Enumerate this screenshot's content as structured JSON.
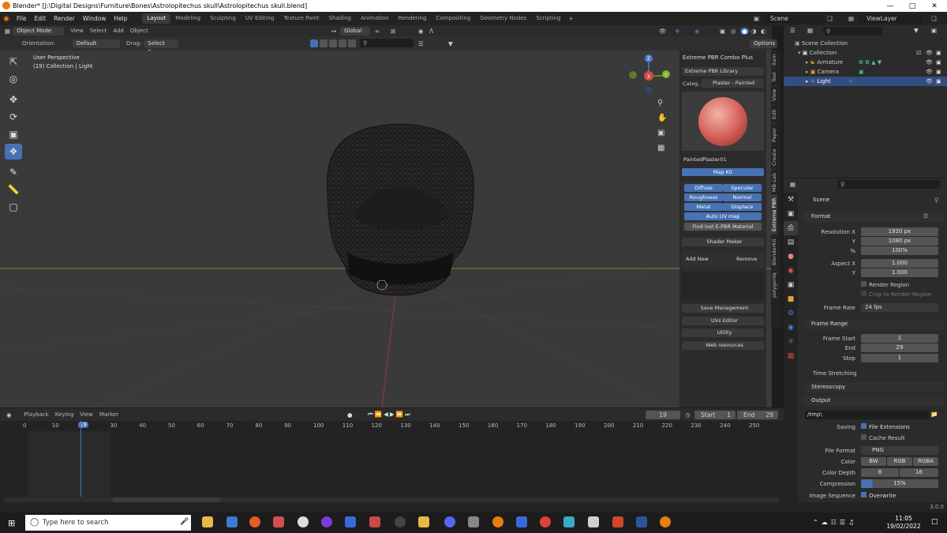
{
  "window": {
    "title": "Blender* [J:\\Digital Designs\\Furniture\\Bones\\Astrolopitechus skull\\Astrolopitechus skull.blend]"
  },
  "menu": [
    "File",
    "Edit",
    "Render",
    "Window",
    "Help"
  ],
  "workspaces": [
    "Layout",
    "Modeling",
    "Sculpting",
    "UV Editing",
    "Texture Paint",
    "Shading",
    "Animation",
    "Rendering",
    "Compositing",
    "Geometry Nodes",
    "Scripting"
  ],
  "scene": {
    "label": "Scene",
    "viewlayer": "ViewLayer"
  },
  "vp_header": {
    "mode": "Object Mode",
    "view": "View",
    "select": "Select",
    "add": "Add",
    "object": "Object",
    "transform": "Global"
  },
  "vp_header2": {
    "orientation_label": "Orientation:",
    "orientation": "Default",
    "drag_label": "Drag:",
    "drag": "Select Box",
    "options": "Options"
  },
  "overlay": {
    "line1": "User Perspective",
    "line2": "(19) Collection | Light"
  },
  "npanel": {
    "title": "Extreme PBR Combo Plus",
    "library": "Extreme PBR Library",
    "category_label": "Categ...",
    "category": "Plaster - Painted",
    "material": "PaintedPlaster01",
    "map_kit": "Map Kit",
    "maps": [
      "Diffuse",
      "Specular",
      "Roughness",
      "Normal",
      "Metal",
      "Displace"
    ],
    "auto_uv": "Auto UV map",
    "find_lost": "Find lost E-PBR Material",
    "shader_maker": "Shader Maker",
    "add_new": "Add New",
    "remove": "Remove",
    "sections": [
      "Save Management",
      "UVs Editor",
      "Utility",
      "Web resources"
    ]
  },
  "ntabs": [
    "Item",
    "Tool",
    "View",
    "Edit",
    "Paper",
    "Create",
    "MB-Lab",
    "Extreme PBR",
    "BlenderKit",
    "polygoniq"
  ],
  "outliner": {
    "root": "Scene Collection",
    "collection": "Collection",
    "items": [
      "Armature",
      "Camera",
      "Light"
    ]
  },
  "props": {
    "scene": "Scene",
    "format": "Format",
    "res_x_label": "Resolution X",
    "res_x": "1920 px",
    "res_y_label": "Y",
    "res_y": "1080 px",
    "pct_label": "%",
    "pct": "100%",
    "aspect_x_label": "Aspect X",
    "aspect_x": "1.000",
    "aspect_y_label": "Y",
    "aspect_y": "1.000",
    "render_region": "Render Region",
    "crop": "Crop to Render Region",
    "framerate_label": "Frame Rate",
    "framerate": "24 fps",
    "frame_range": "Frame Range",
    "fstart_label": "Frame Start",
    "fstart": "1",
    "fend_label": "End",
    "fend": "29",
    "fstep_label": "Step",
    "fstep": "1",
    "time_stretch": "Time Stretching",
    "stereo": "Stereoscopy",
    "output": "Output",
    "path": "/tmp\\",
    "saving_label": "Saving",
    "file_ext": "File Extensions",
    "cache": "Cache Result",
    "file_format_label": "File Format",
    "file_format": "PNG",
    "color_label": "Color",
    "color_opts": [
      "BW",
      "RGB",
      "RGBA"
    ],
    "depth_label": "Color Depth",
    "depth_opts": [
      "8",
      "16"
    ],
    "compression_label": "Compression",
    "compression": "15%",
    "imgseq_label": "Image Sequence",
    "overwrite": "Overwrite"
  },
  "timeline": {
    "menus": [
      "Playback",
      "Keying",
      "View",
      "Marker"
    ],
    "current": "19",
    "start_label": "Start",
    "start": "1",
    "end_label": "End",
    "end": "29",
    "ticks": [
      "0",
      "10",
      "19",
      "30",
      "40",
      "50",
      "60",
      "70",
      "80",
      "90",
      "100",
      "110",
      "120",
      "130",
      "140",
      "150",
      "160",
      "170",
      "180",
      "190",
      "200",
      "210",
      "220",
      "230",
      "240",
      "250"
    ]
  },
  "status": {
    "version": "3.0.0"
  },
  "taskbar": {
    "search": "Type here to search",
    "time": "11:05",
    "date": "19/02/2022"
  },
  "colors": {
    "accent": "#4772b3",
    "select": "#334d80"
  }
}
